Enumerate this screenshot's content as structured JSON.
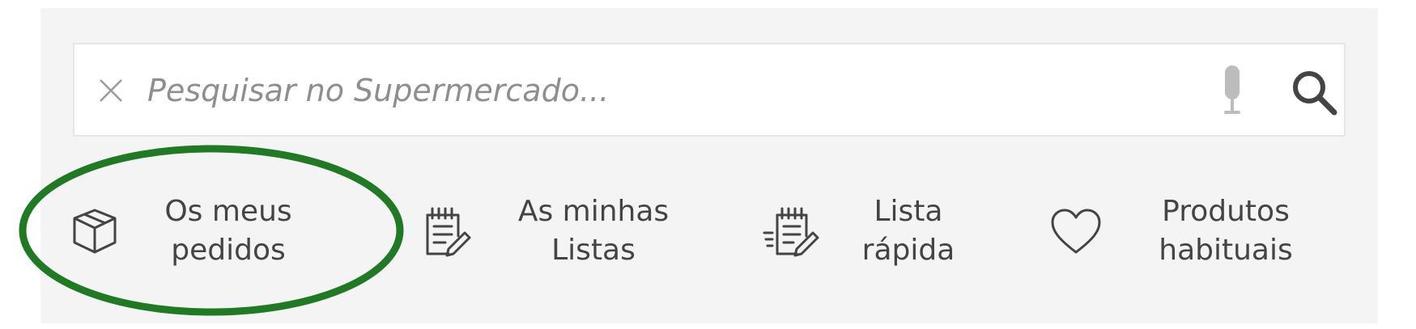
{
  "search": {
    "placeholder": "Pesquisar no Supermercado...",
    "value": "",
    "clear_icon": "close-icon",
    "mic_icon": "microphone-icon",
    "submit_icon": "search-icon"
  },
  "shortcuts": [
    {
      "line1": "Os meus",
      "line2": "pedidos",
      "icon": "box-icon"
    },
    {
      "line1": "As minhas",
      "line2": "Listas",
      "icon": "notepad-icon"
    },
    {
      "line1": "Lista",
      "line2": "rápida",
      "icon": "quick-list-icon"
    },
    {
      "line1": "Produtos",
      "line2": "habituais",
      "icon": "heart-icon"
    }
  ],
  "colors": {
    "panel_background": "#f4f4f4",
    "highlight": "#1f7a23",
    "icon": "#444444"
  }
}
